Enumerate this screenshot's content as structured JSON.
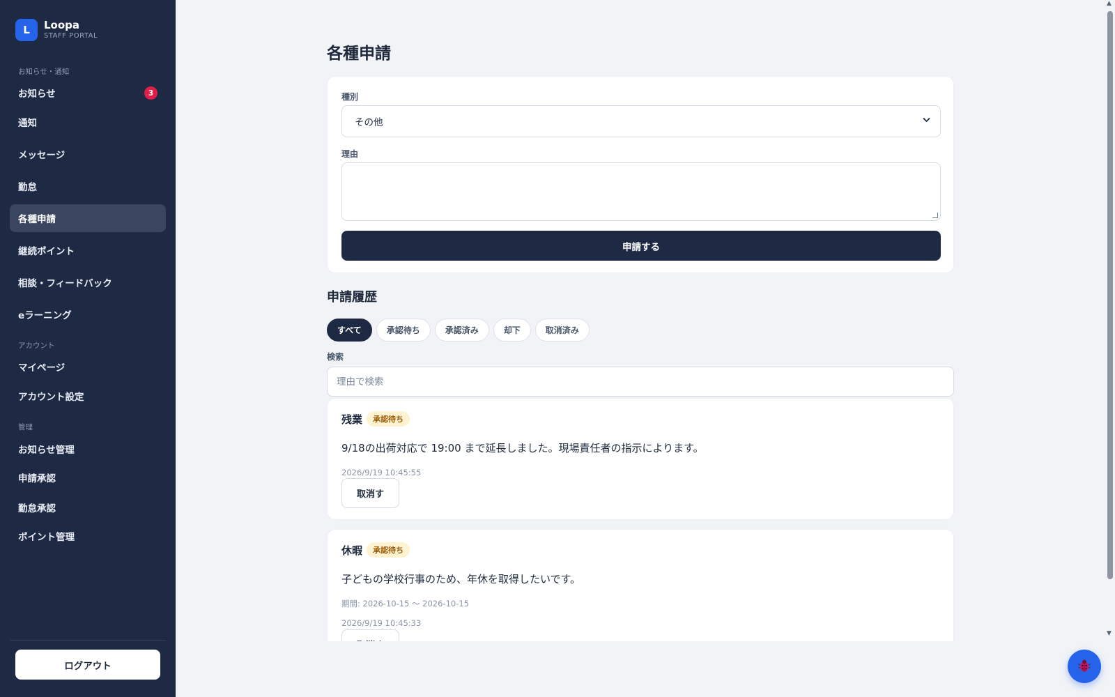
{
  "brand": {
    "logo_letter": "L",
    "name": "Loopa",
    "subtitle": "STAFF PORTAL"
  },
  "sidebar": {
    "sections": [
      {
        "label": "お知らせ・通知"
      },
      {
        "label": "アカウント"
      },
      {
        "label": "管理"
      }
    ],
    "items": [
      {
        "label": "お知らせ",
        "badge": "3"
      },
      {
        "label": "通知"
      },
      {
        "label": "メッセージ"
      },
      {
        "label": "勤怠"
      },
      {
        "label": "各種申請",
        "active": true
      },
      {
        "label": "継続ポイント"
      },
      {
        "label": "相談・フィードバック"
      },
      {
        "label": "eラーニング"
      },
      {
        "label": "マイページ"
      },
      {
        "label": "アカウント設定"
      },
      {
        "label": "お知らせ管理"
      },
      {
        "label": "申請承認"
      },
      {
        "label": "勤怠承認"
      },
      {
        "label": "ポイント管理"
      }
    ],
    "logout_label": "ログアウト"
  },
  "main": {
    "page_title": "各種申請",
    "form": {
      "type_label": "種別",
      "type_value": "その他",
      "reason_label": "理由",
      "reason_value": "",
      "submit_label": "申請する"
    },
    "history": {
      "title": "申請履歴",
      "filters": [
        "すべて",
        "承認待ち",
        "承認済み",
        "却下",
        "取消済み"
      ],
      "active_filter": "すべて",
      "search_label": "検索",
      "search_placeholder": "理由で検索",
      "requests": [
        {
          "type": "残業",
          "status": "承認待ち",
          "reason": "9/18の出荷対応で 19:00 まで延長しました。現場責任者の指示によります。",
          "period": "",
          "timestamp": "2026/9/19 10:45:55",
          "cancel_label": "取消す"
        },
        {
          "type": "休暇",
          "status": "承認待ち",
          "reason": "子どもの学校行事のため、年休を取得したいです。",
          "period": "期間: 2026-10-15 〜 2026-10-15",
          "timestamp": "2026/9/19 10:45:33",
          "cancel_label": "取消す"
        }
      ]
    }
  },
  "colors": {
    "sidebar_bg": "#1e2a44",
    "accent": "#2563eb",
    "badge": "#e11d48",
    "pending_bg": "#fdf3d0",
    "pending_text": "#9a5b0b"
  },
  "icons": {
    "floating_button": "bug-icon",
    "select": "chevron-down-icon"
  }
}
